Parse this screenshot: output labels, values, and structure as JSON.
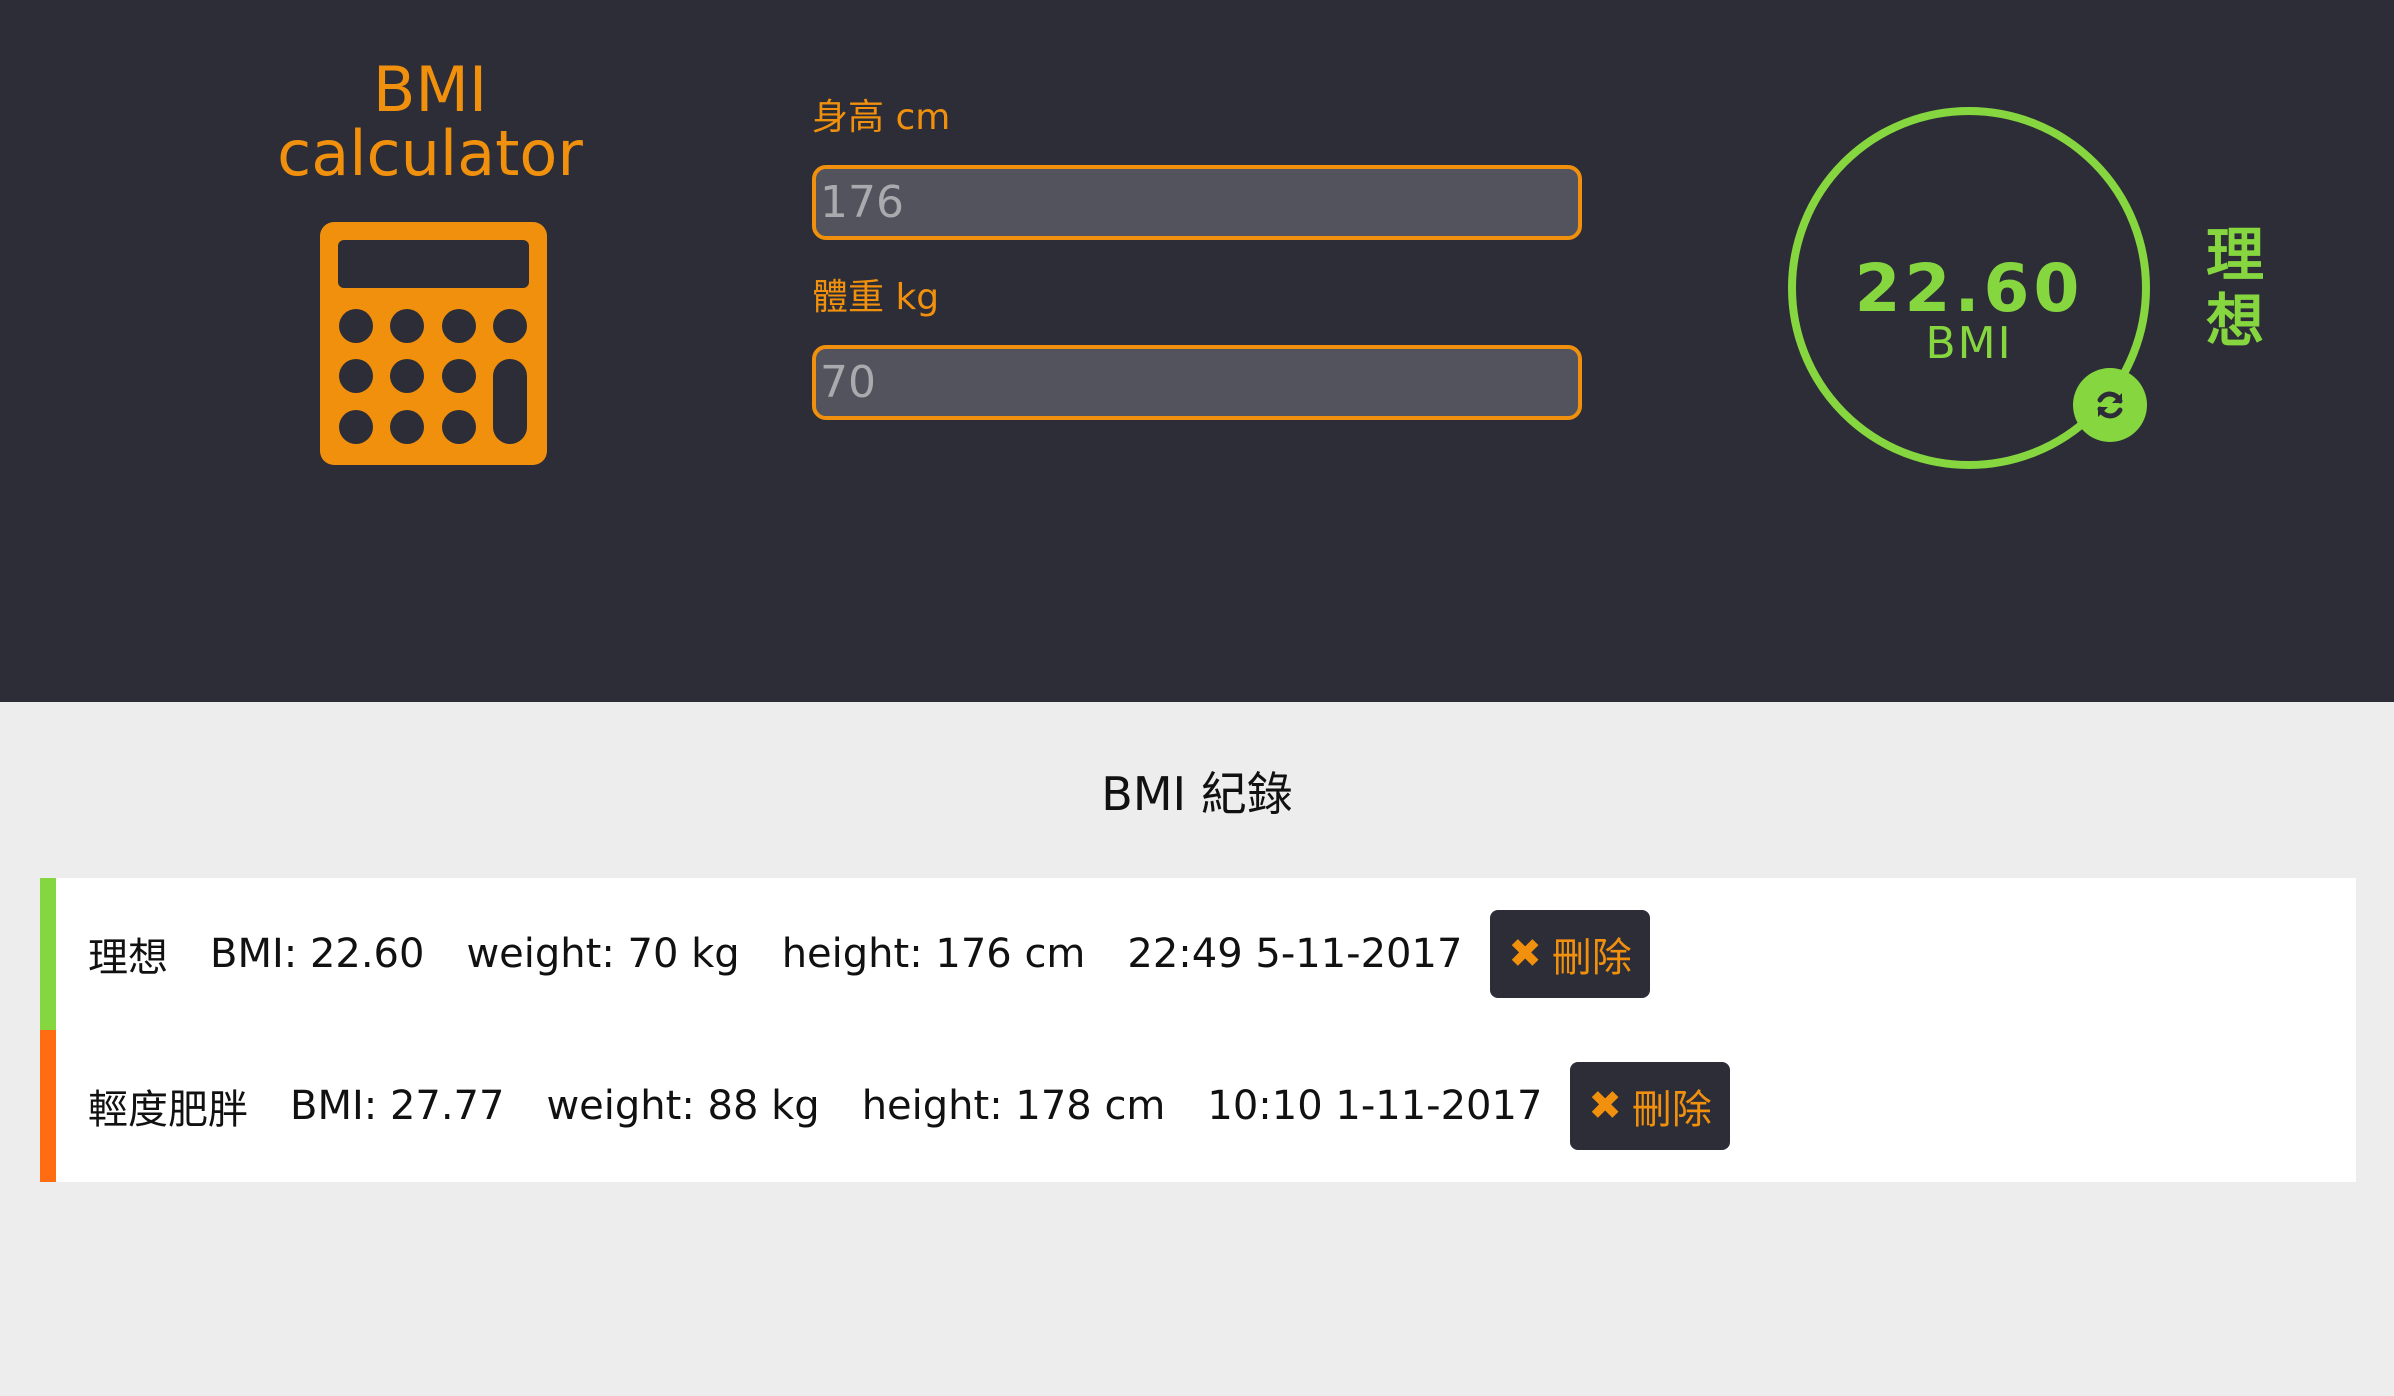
{
  "brand": {
    "line1": "BMI",
    "line2": "calculator",
    "icon": "calculator-icon"
  },
  "form": {
    "height_label": "身高 cm",
    "height_value": "176",
    "weight_label": "體重 kg",
    "weight_value": "70"
  },
  "result": {
    "bmi_value": "22.60",
    "unit": "BMI",
    "status": "理想",
    "refresh_icon": "refresh-icon",
    "color": "#86d73f"
  },
  "records": {
    "title": "BMI 紀錄",
    "items": [
      {
        "status": "理想",
        "bmi": "BMI: 22.60",
        "weight": "weight: 70 kg",
        "height": "height: 176 cm",
        "time": "22:49 5-11-2017",
        "delete_label": "刪除",
        "color": "#86d73f"
      },
      {
        "status": "輕度肥胖",
        "bmi": "BMI: 27.77",
        "weight": "weight: 88 kg",
        "height": "height: 178 cm",
        "time": "10:10 1-11-2017",
        "delete_label": "刪除",
        "color": "#ff6c11"
      }
    ]
  },
  "colors": {
    "header_bg": "#2c2d37",
    "accent": "#f0900d",
    "ideal": "#86d73f",
    "overweight": "#ff6c11"
  }
}
